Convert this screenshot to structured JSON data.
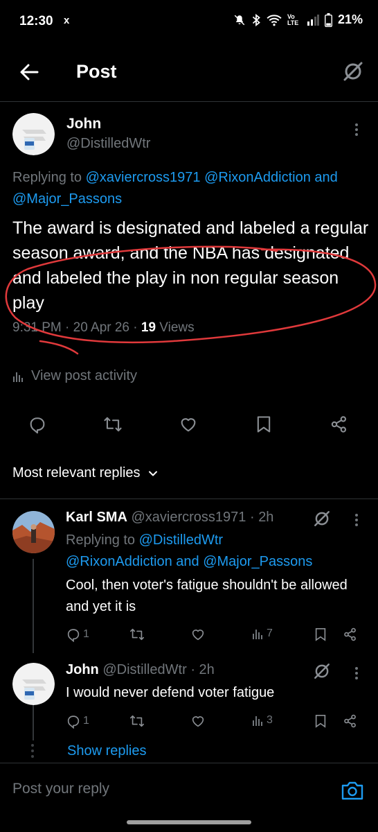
{
  "status_bar": {
    "time": "12:30",
    "notification": "x",
    "battery": "21%",
    "network": "Vo LTE"
  },
  "header": {
    "title": "Post",
    "back_icon": "arrow-left-icon",
    "grok_icon": "grok-icon"
  },
  "main_post": {
    "name": "John",
    "handle": "@DistilledWtr",
    "replying_prefix": "Replying to ",
    "replying_line1_mentions": "@xaviercross1971 @RixonAddiction and",
    "replying_line2_mentions": "@Major_Passons",
    "text": "The award is designated and labeled a regular season award, and the NBA has designated and labeled the play in non regular season play",
    "time": "9:31 PM",
    "separator": " · ",
    "date": "20 Apr 26",
    "views_count": "19",
    "views_label": " Views",
    "view_activity": "View post activity",
    "annotation_color": "#e0393b"
  },
  "actions": [
    "reply-icon",
    "repost-icon",
    "like-icon",
    "bookmark-icon",
    "share-icon"
  ],
  "replies_filter": "Most relevant replies",
  "replies": [
    {
      "name": "Karl SMA",
      "handle": "@xaviercross1971",
      "time": "2h",
      "replying_prefix": "Replying to ",
      "replying_line1": "@DistilledWtr",
      "replying_line2": "@RixonAddiction and @Major_Passons",
      "text": "Cool, then voter's fatigue shouldn't be allowed and yet it is",
      "reply_count": "1",
      "views": "7"
    },
    {
      "name": "John",
      "handle": "@DistilledWtr",
      "time": "2h",
      "text": "I would never defend voter fatigue",
      "reply_count": "1",
      "views": "3"
    }
  ],
  "show_replies": "Show replies",
  "reply_input": {
    "placeholder": "Post your reply"
  },
  "colors": {
    "background": "#000000",
    "accent": "#1d9bf0",
    "muted": "#71767b",
    "text": "#e7e9ea"
  }
}
